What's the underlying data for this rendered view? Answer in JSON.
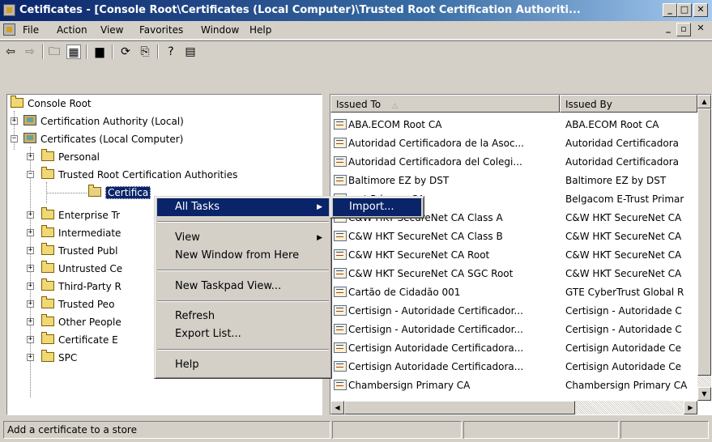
{
  "window": {
    "title": "Cetificates - [Console Root\\Certificates (Local Computer)\\Trusted Root Certification Authoriti..."
  },
  "menubar": {
    "items": [
      "File",
      "Action",
      "View",
      "Favorites",
      "Window",
      "Help"
    ]
  },
  "tree": {
    "root": "Console Root",
    "ca_local": "Certification Authority (Local)",
    "certs_local": "Certificates (Local Computer)",
    "personal": "Personal",
    "trusted_root": "Trusted Root Certification Authorities",
    "certificates": "Certifica",
    "enterprise": "Enterprise Tr",
    "intermediate": "Intermediate",
    "trusted_pub": "Trusted Publ",
    "untrusted": "Untrusted Ce",
    "third_party": "Third-Party R",
    "trusted_people": "Trusted Peo",
    "other_people": "Other People",
    "cert_enroll": "Certificate E",
    "spc": "SPC"
  },
  "list": {
    "columns": [
      "Issued To",
      "Issued By"
    ],
    "rows": [
      [
        "ABA.ECOM Root CA",
        "ABA.ECOM Root CA"
      ],
      [
        "Autoridad Certificadora de la Asoc...",
        "Autoridad Certificadora"
      ],
      [
        "Autoridad Certificadora del Colegi...",
        "Autoridad Certificadora"
      ],
      [
        "Baltimore EZ by DST",
        "Baltimore EZ by DST"
      ],
      [
        "rust Primary CA",
        "Belgacom E-Trust Primar"
      ],
      [
        "C&W HKT SecureNet CA Class A",
        "C&W HKT SecureNet CA"
      ],
      [
        "C&W HKT SecureNet CA Class B",
        "C&W HKT SecureNet CA"
      ],
      [
        "C&W HKT SecureNet CA Root",
        "C&W HKT SecureNet CA"
      ],
      [
        "C&W HKT SecureNet CA SGC Root",
        "C&W HKT SecureNet CA"
      ],
      [
        "Cartão de Cidadão 001",
        "GTE CyberTrust Global R"
      ],
      [
        "Certisign - Autoridade Certificador...",
        "Certisign - Autoridade C"
      ],
      [
        "Certisign - Autoridade Certificador...",
        "Certisign - Autoridade C"
      ],
      [
        "Certisign Autoridade Certificadora...",
        "Certisign Autoridade Ce"
      ],
      [
        "Certisign Autoridade Certificadora...",
        "Certisign Autoridade Ce"
      ],
      [
        "Chambersign Primary CA",
        "Chambersign Primary CA"
      ]
    ]
  },
  "context_menu": {
    "all_tasks": "All Tasks",
    "view": "View",
    "new_window": "New Window from Here",
    "new_taskpad": "New Taskpad View...",
    "refresh": "Refresh",
    "export_list": "Export List...",
    "help": "Help"
  },
  "submenu": {
    "import": "Import..."
  },
  "status": {
    "text": "Add a certificate to a store"
  }
}
